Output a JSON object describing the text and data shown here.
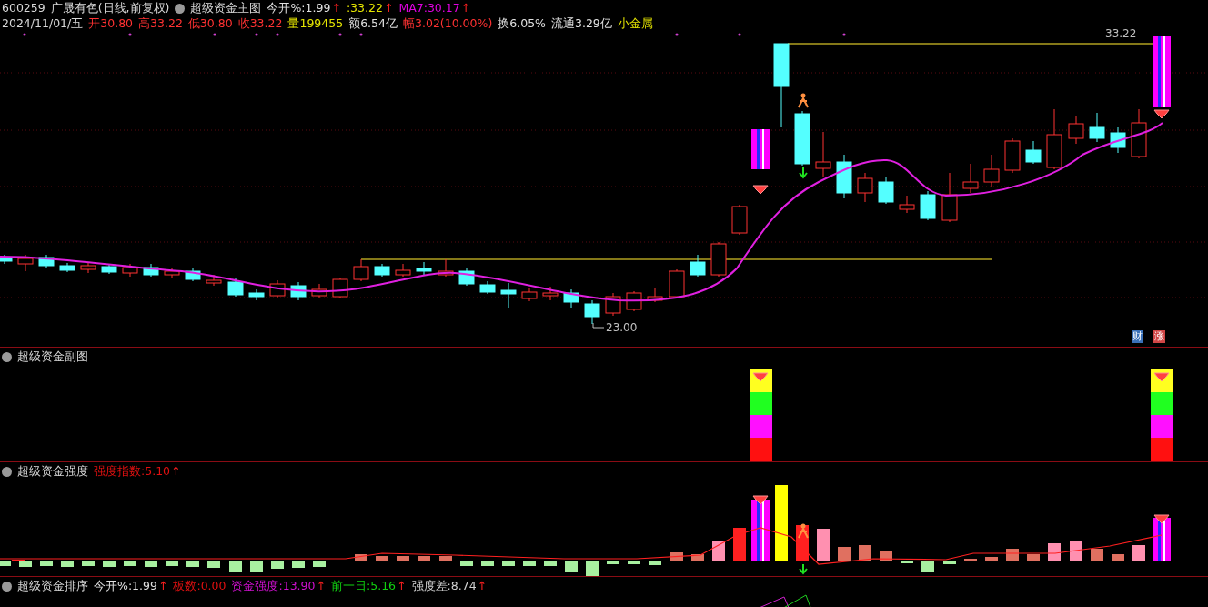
{
  "main_chart": {
    "code": "600259",
    "security": "广晟有色(日线,前复权)",
    "indicator": "超级资金主图",
    "fields": [
      {
        "label": "今开%:",
        "value": "1.99",
        "arrow": "↑",
        "color": "#e0e0e0"
      },
      {
        "label": ":",
        "value": "33.22",
        "arrow": "↑",
        "color": "#e6e600"
      },
      {
        "label": "MA7:",
        "value": "30.17",
        "arrow": "↑",
        "color": "#e000e0"
      }
    ],
    "date": "2024/11/01/五",
    "quote": [
      {
        "label": "开",
        "value": "30.80",
        "color": "#ff3232"
      },
      {
        "label": "高",
        "value": "33.22",
        "color": "#ff3232"
      },
      {
        "label": "低",
        "value": "30.80",
        "color": "#ff3232"
      },
      {
        "label": "收",
        "value": "33.22",
        "color": "#ff3232"
      },
      {
        "label": "量",
        "value": "199455",
        "color": "#e6e600"
      },
      {
        "label": "额",
        "value": "6.54亿",
        "color": "#e0e0e0"
      },
      {
        "label": "幅",
        "value": "3.02(10.00%)",
        "color": "#ff3232"
      },
      {
        "label": "换",
        "value": "6.05%",
        "color": "#e0e0e0"
      },
      {
        "label": "流通",
        "value": "3.29亿",
        "color": "#e0e0e0"
      }
    ],
    "sector": "小金属",
    "high_label": "33.22",
    "low_label": "23.00",
    "badges": [
      {
        "text": "财",
        "color": "#3a70b8"
      },
      {
        "text": "涨",
        "color": "#d04545"
      }
    ]
  },
  "sub_chart": {
    "title": "超级资金副图"
  },
  "strength_chart": {
    "title": "超级资金强度",
    "fields": [
      {
        "label": "强度指数:",
        "value": "5.10",
        "arrow": "↑",
        "color": "#e01010"
      }
    ]
  },
  "ranking_chart": {
    "title": "超级资金排序",
    "fields": [
      {
        "label": "今开%:",
        "value": "1.99",
        "arrow": "↑",
        "color": "#e0e0e0"
      },
      {
        "label": "板数:",
        "value": "0.00",
        "color": "#e01010"
      },
      {
        "label": "资金强度:",
        "value": "13.90",
        "arrow": "↑",
        "color": "#d010d0"
      },
      {
        "label": "前一日:",
        "value": "5.16",
        "arrow": "↑",
        "color": "#10d010"
      },
      {
        "label": "强度差:",
        "value": "8.74",
        "arrow": "↑",
        "color": "#d0d0d0"
      }
    ]
  }
}
